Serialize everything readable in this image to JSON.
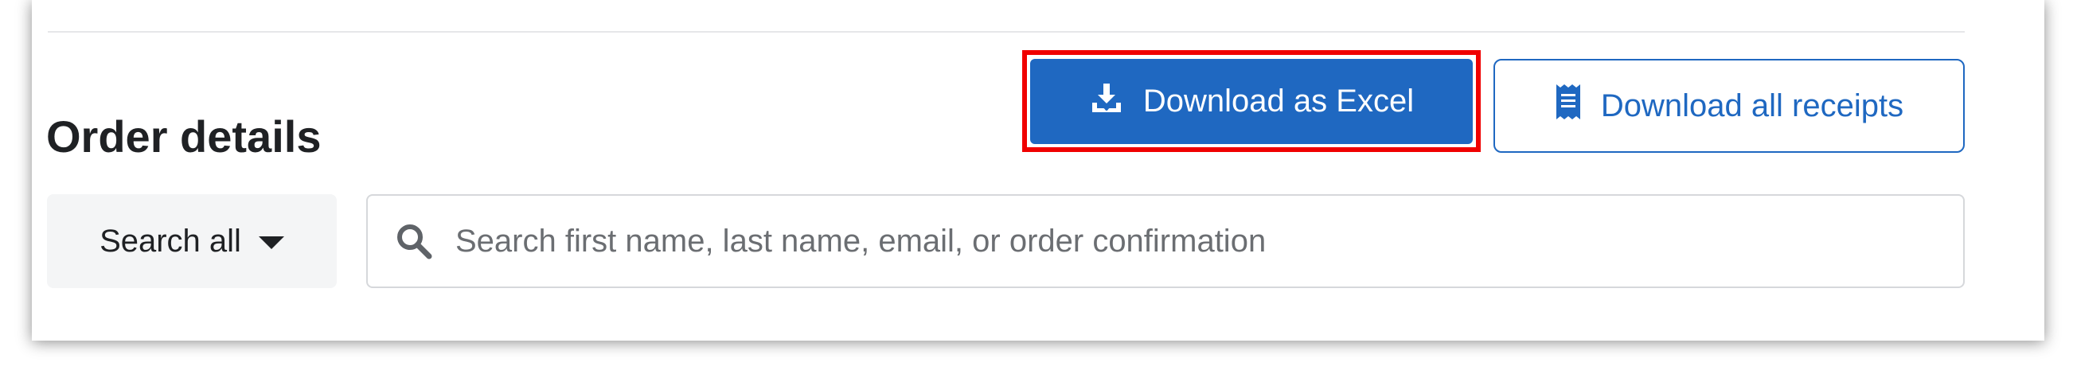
{
  "section": {
    "title": "Order details"
  },
  "actions": {
    "download_excel_label": "Download as Excel",
    "download_excel_icon": "download-icon",
    "download_receipts_label": "Download all receipts",
    "download_receipts_icon": "receipt-icon"
  },
  "search": {
    "scope_label": "Search all",
    "scope_icon": "caret-down-icon",
    "placeholder": "Search first name, last name, email, or order confirmation",
    "value": "",
    "icon": "search-icon"
  },
  "colors": {
    "primary": "#1f68c1",
    "highlight": "#f00000",
    "text": "#1f2124",
    "muted": "#6b6e72"
  }
}
